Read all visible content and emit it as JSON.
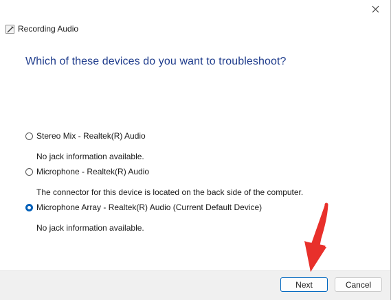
{
  "window": {
    "title": "Recording Audio",
    "close_glyph": "✕"
  },
  "heading": "Which of these devices do you want to troubleshoot?",
  "options": [
    {
      "label": "Stereo Mix - Realtek(R) Audio",
      "description": "No jack information available.",
      "checked": false
    },
    {
      "label": "Microphone - Realtek(R) Audio",
      "description": "The connector for this device is located on the back side of the computer.",
      "checked": false
    },
    {
      "label": "Microphone Array - Realtek(R) Audio (Current Default Device)",
      "description": "No jack information available.",
      "checked": true
    }
  ],
  "footer": {
    "next_label": "Next",
    "cancel_label": "Cancel"
  },
  "colors": {
    "heading": "#1f3c8c",
    "accent": "#005fb8",
    "annotation_arrow": "#e8302b"
  }
}
